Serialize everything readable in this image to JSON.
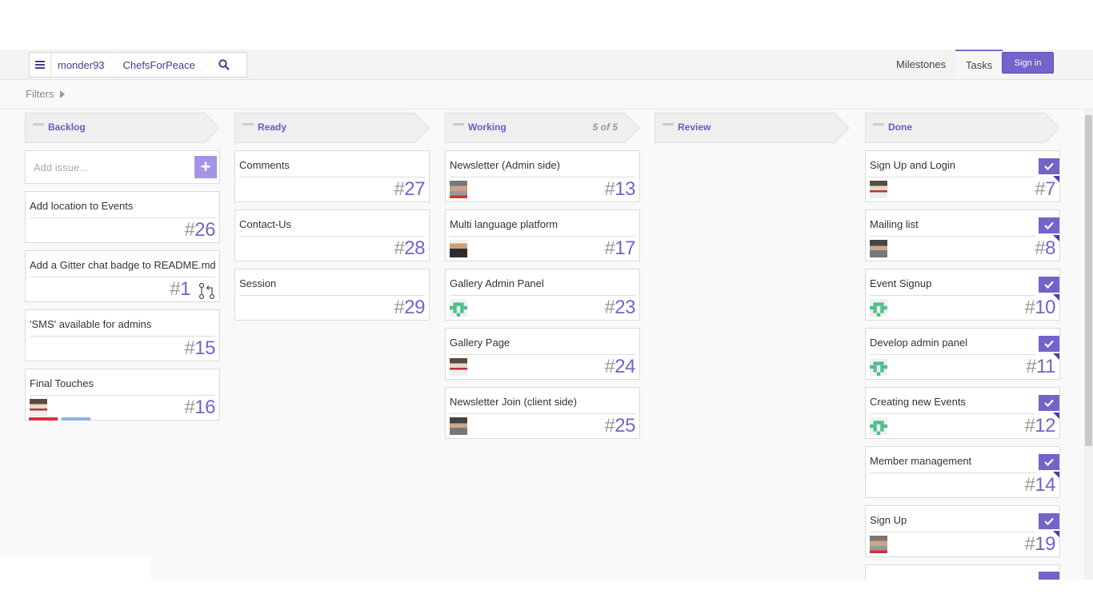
{
  "header": {
    "breadcrumb": [
      "monder93",
      "ChefsForPeace"
    ],
    "nav": {
      "milestones": "Milestones",
      "tasks": "Tasks"
    },
    "signin": "Sign in"
  },
  "filters": {
    "label": "Filters"
  },
  "add_issue": {
    "placeholder": "Add issue...",
    "plus": "+"
  },
  "columns": [
    {
      "name": "Backlog",
      "count": "",
      "cards": [
        {
          "title": "Add location to Events",
          "hash": "#",
          "number": "26"
        },
        {
          "title": "Add a Gitter chat badge to README.md",
          "hash": "#",
          "number": "1"
        },
        {
          "title": "'SMS' available for admins",
          "hash": "#",
          "number": "15"
        },
        {
          "title": "Final Touches",
          "hash": "#",
          "number": "16"
        }
      ]
    },
    {
      "name": "Ready",
      "count": "",
      "cards": [
        {
          "title": "Comments",
          "hash": "#",
          "number": "27"
        },
        {
          "title": "Contact-Us",
          "hash": "#",
          "number": "28"
        },
        {
          "title": "Session",
          "hash": "#",
          "number": "29"
        }
      ]
    },
    {
      "name": "Working",
      "count": "5 of 5",
      "cards": [
        {
          "title": "Newsletter (Admin side)",
          "hash": "#",
          "number": "13"
        },
        {
          "title": "Multi language platform",
          "hash": "#",
          "number": "17"
        },
        {
          "title": "Gallery Admin Panel",
          "hash": "#",
          "number": "23"
        },
        {
          "title": "Gallery Page",
          "hash": "#",
          "number": "24"
        },
        {
          "title": "Newsletter Join (client side)",
          "hash": "#",
          "number": "25"
        }
      ]
    },
    {
      "name": "Review",
      "count": "",
      "cards": []
    },
    {
      "name": "Done",
      "count": "",
      "cards": [
        {
          "title": "Sign Up and Login",
          "hash": "#",
          "number": "7"
        },
        {
          "title": "Mailing list",
          "hash": "#",
          "number": "8"
        },
        {
          "title": "Event Signup",
          "hash": "#",
          "number": "10"
        },
        {
          "title": "Develop admin panel",
          "hash": "#",
          "number": "11"
        },
        {
          "title": "Creating new Events",
          "hash": "#",
          "number": "12"
        },
        {
          "title": "Member management",
          "hash": "#",
          "number": "14"
        },
        {
          "title": "Sign Up",
          "hash": "#",
          "number": "19"
        }
      ]
    }
  ],
  "colors": {
    "accent": "#7463c9",
    "label_red": "#e03030",
    "label_blue": "#8ab4e8"
  }
}
